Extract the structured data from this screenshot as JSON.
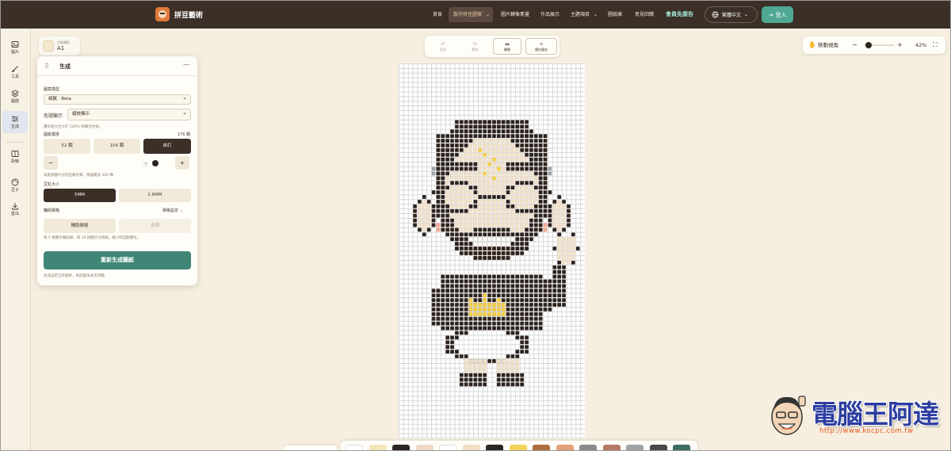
{
  "app": {
    "name": "拼豆藝術"
  },
  "nav": {
    "items": [
      {
        "label": "首頁"
      },
      {
        "label": "製作拼豆圖案"
      },
      {
        "label": "圖片轉像素畫"
      },
      {
        "label": "作品展示"
      },
      {
        "label": "主題項目"
      },
      {
        "label": "圖紙庫"
      },
      {
        "label": "意見回饋"
      }
    ],
    "premium": "會員免廣告",
    "language": "繁體中文",
    "login": "登入"
  },
  "rail": {
    "items": [
      {
        "label": "圖片",
        "icon": "image-icon"
      },
      {
        "label": "工具",
        "icon": "brush-icon"
      },
      {
        "label": "圖層",
        "icon": "layers-icon"
      },
      {
        "label": "生成",
        "icon": "sliders-icon"
      },
      {
        "label": "對稱",
        "icon": "symmetry-icon"
      },
      {
        "label": "豆子",
        "icon": "palette-icon"
      },
      {
        "label": "匯出",
        "icon": "download-icon"
      }
    ],
    "active": "生成"
  },
  "current_color": {
    "label": "目前顏色",
    "code": "A1",
    "swatch": "#f3e7cc"
  },
  "generate": {
    "title": "生成",
    "mode_label": "圖案模型",
    "mode_value": "細膩 · Beta",
    "color_display_label": "色號顯示",
    "color_display_value": "縮放顯示",
    "zoom_note": "畫布放大至大於 200% 時顯示色號。",
    "width_label": "圖紙寬度",
    "width_value": "176 顆",
    "width_options": [
      "52 顆",
      "104 顆",
      "自訂"
    ],
    "width_selected": "自訂",
    "minus": "−",
    "plus": "+",
    "width_hint": "高度依圖片比例自動計算，單邊最多 300 顆",
    "bead_size_label": "豆粒大小",
    "bead_sizes": [
      "5MM",
      "2.6MM"
    ],
    "bead_size_selected": "5MM",
    "guide_label": "輔助網格",
    "guide_setting": "網格設定",
    "guide_buttons": [
      "輔助網格",
      "座標"
    ],
    "guide_hint": "每 5 格顯示輔助線，每 10 格顯示大格線，縮小時自動簡化。",
    "regenerate": "重新生成圖紙",
    "footer_note": "生成設定已有變更，目前圖未再次改變。"
  },
  "canvas_toolbar": {
    "items": [
      {
        "label": "復原",
        "glyph": "↶",
        "enabled": false
      },
      {
        "label": "重做",
        "glyph": "↷",
        "enabled": false
      },
      {
        "label": "鏡像",
        "glyph": "⇹",
        "enabled": true
      },
      {
        "label": "隨光優化",
        "glyph": "✧",
        "enabled": true
      }
    ]
  },
  "view": {
    "move_label": "移動視角",
    "zoom": "42%",
    "zoom_fraction": 0.15
  },
  "palette": {
    "colors": [
      "#ffffff",
      "#f4e6b8",
      "#2e2622",
      "#efd9c7",
      "#ffffff",
      "#f1dfc4",
      "#2c2624",
      "#f3d35a",
      "#b06e3f",
      "#e3a07a",
      "#8b8b8b",
      "#b77a66",
      "#9ea3a6",
      "#484848",
      "#3d6d63"
    ]
  },
  "watermark": {
    "title": "電腦王阿達",
    "url": "http://www.kocpc.com.tw"
  },
  "colors": {
    "topbar": "#3b2f28",
    "accent": "#3f8677",
    "bead_dark": "#2d231e",
    "bead_skin": "#f1dfc6",
    "bead_mouth": "#e07b52",
    "bead_cheek": "#f4a893",
    "bead_crown": "#f4cf45",
    "bead_gray": "#9ea3a6"
  }
}
